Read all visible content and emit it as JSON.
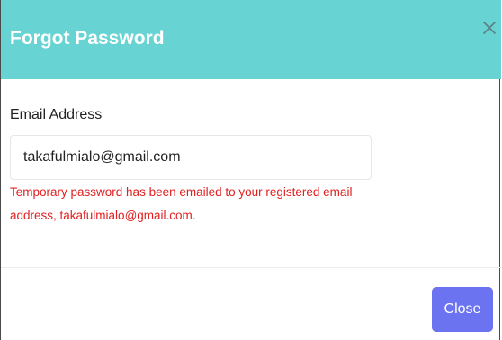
{
  "modal": {
    "title": "Forgot Password",
    "close_icon": "close-icon",
    "header_color": "#68d3d3"
  },
  "form": {
    "email_label": "Email Address",
    "email_value": "takafulmialo@gmail.com"
  },
  "message": {
    "line1": "Temporary password has been emailed to your registered email",
    "line2": "address, takafulmialo@gmail.com.",
    "color": "#e02020"
  },
  "footer": {
    "close_label": "Close",
    "button_color": "#6b73f0"
  }
}
